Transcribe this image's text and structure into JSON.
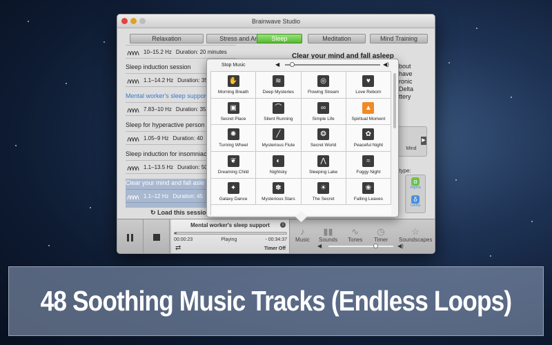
{
  "window": {
    "title": "Brainwave Studio"
  },
  "tabs": [
    {
      "label": "Relaxation"
    },
    {
      "label": "Stress and Anxiety"
    },
    {
      "label": "Sleep"
    },
    {
      "label": "Meditation"
    },
    {
      "label": "Mind Training"
    }
  ],
  "active_tab": "Sleep",
  "sessions": [
    {
      "name": "",
      "freq": "10–15.2 Hz",
      "duration": "Duration: 20 minutes"
    },
    {
      "name": "Sleep induction session",
      "freq": "1.1–14.2 Hz",
      "duration": "Duration: 35"
    },
    {
      "name": "Mental worker's sleep support",
      "freq": "7.83–10 Hz",
      "duration": "Duration: 35"
    },
    {
      "name": "Sleep for hyperactive person",
      "freq": "1.05–9 Hz",
      "duration": "Duration: 40"
    },
    {
      "name": "Sleep induction for insomniac",
      "freq": "1.1–13.5 Hz",
      "duration": "Duration: 50"
    },
    {
      "name": "Clear your mind and fall asle",
      "freq": "1.1–12 Hz",
      "duration": "Duration: 45"
    }
  ],
  "load_session_label": "Load this session",
  "description": {
    "title": "Clear your mind and fall asleep",
    "fragments": [
      "bout",
      "have",
      "ronic",
      "Delta",
      "ttery"
    ]
  },
  "mind_label": "Mind",
  "content_type": {
    "label": "ent type:",
    "items": [
      {
        "glyph": "α",
        "name": "Alpha"
      },
      {
        "glyph": "δ",
        "name": "Delta"
      }
    ]
  },
  "player": {
    "title": "Mental worker's sleep support",
    "elapsed": "00:00:23",
    "status": "Playing",
    "remaining": "- 00:34:37",
    "timer": "Timer Off",
    "progress": 0.02
  },
  "toolbar": [
    {
      "label": "Music",
      "icon": "music-note-icon",
      "glyph": "♪"
    },
    {
      "label": "Sounds",
      "icon": "sounds-icon",
      "glyph": "▮▮"
    },
    {
      "label": "Tones",
      "icon": "tones-icon",
      "glyph": "∿"
    },
    {
      "label": "Timer",
      "icon": "timer-icon",
      "glyph": "◷"
    },
    {
      "label": "Soundscapes",
      "icon": "star-icon",
      "glyph": "☆"
    }
  ],
  "volume": {
    "level": 0.72
  },
  "music_popover": {
    "stop_label": "Stop Music",
    "volume_level": 0.05,
    "tracks": [
      {
        "name": "Morning Breath",
        "glyph": "✋"
      },
      {
        "name": "Deep Mysteries",
        "glyph": "≋"
      },
      {
        "name": "Flowing Stream",
        "glyph": "◎"
      },
      {
        "name": "Love Reborn",
        "glyph": "♥"
      },
      {
        "name": "Secret Place",
        "glyph": "▣"
      },
      {
        "name": "Silent Running",
        "glyph": "⌒"
      },
      {
        "name": "Simple Life",
        "glyph": "∞"
      },
      {
        "name": "Spiritual Moment",
        "glyph": "▲",
        "highlight": true
      },
      {
        "name": "Turning Wheel",
        "glyph": "✺"
      },
      {
        "name": "Mysterious Flute",
        "glyph": "╱"
      },
      {
        "name": "Secret World",
        "glyph": "❂"
      },
      {
        "name": "Peaceful Night",
        "glyph": "✿"
      },
      {
        "name": "Dreaming Child",
        "glyph": "❦"
      },
      {
        "name": "Nightsky",
        "glyph": "◐"
      },
      {
        "name": "Sleeping Lake",
        "glyph": "⋀"
      },
      {
        "name": "Foggy Night",
        "glyph": "≈"
      },
      {
        "name": "Galaxy Dance",
        "glyph": "✦"
      },
      {
        "name": "Mysterious Stars",
        "glyph": "✽"
      },
      {
        "name": "The Secret",
        "glyph": "☀"
      },
      {
        "name": "Falling Leaves",
        "glyph": "❀"
      }
    ]
  },
  "caption": "48 Soothing Music Tracks (Endless Loops)"
}
